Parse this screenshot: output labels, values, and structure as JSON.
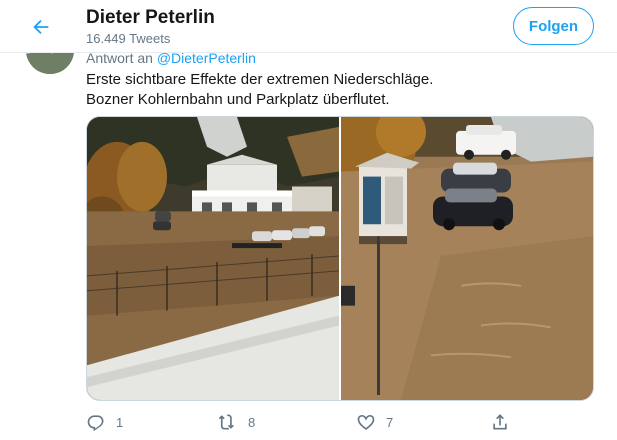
{
  "header": {
    "title": "Dieter Peterlin",
    "subtitle": "16.449 Tweets",
    "follow_label": "Folgen"
  },
  "tweet": {
    "reply_prefix": "Antwort an",
    "reply_mention": "@DieterPeterlin",
    "text_line1": "Erste sichtbare Effekte der extremen Niederschläge.",
    "text_line2": "Bozner Kohlernbahn und Parkplatz überflutet."
  },
  "actions": {
    "reply_count": "1",
    "retweet_count": "8",
    "like_count": "7"
  },
  "colors": {
    "accent": "#1da1f2",
    "muted": "#657786",
    "text": "#14171a",
    "border": "#e6ecf0"
  },
  "icons": {
    "back": "arrow-left-icon",
    "reply": "reply-icon",
    "retweet": "retweet-icon",
    "like": "heart-icon",
    "share": "share-icon"
  }
}
